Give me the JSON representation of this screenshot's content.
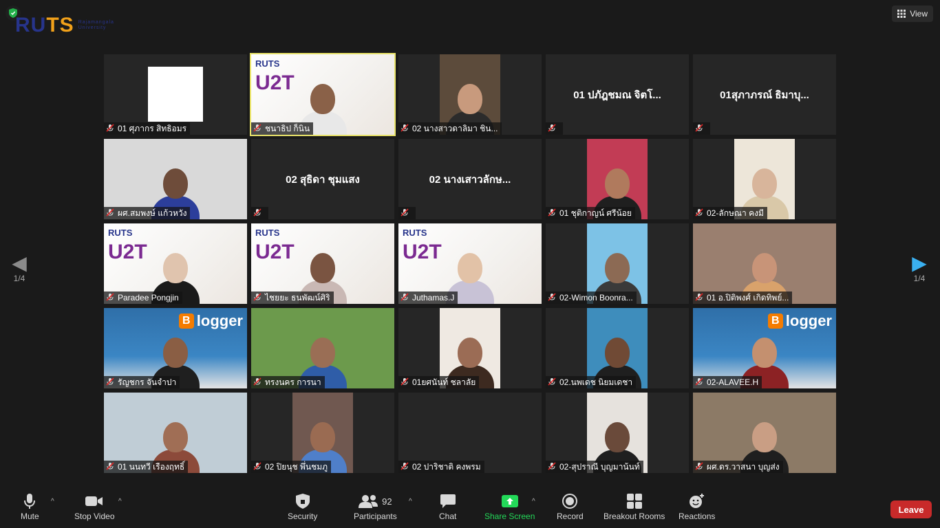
{
  "logo": {
    "part1": "RU",
    "part2": "TS",
    "sub": "Rajamangala University"
  },
  "view": {
    "label": "View"
  },
  "pagination": {
    "left": "1/4",
    "right": "1/4"
  },
  "tiles": [
    {
      "name": "01 ศุภากร สิทธิอมร",
      "type": "blank"
    },
    {
      "name": "ชนาธิป ก็นิน",
      "type": "u2t",
      "skin": "#8a6148",
      "shirt": "#e8e8e8",
      "active": true
    },
    {
      "name": "02 นางสาวดาลิมา ชิน...",
      "type": "narrow",
      "skin": "#c89a7d",
      "shirt": "#2b2b2b",
      "bg": "#5c4b3b"
    },
    {
      "name": "",
      "type": "text",
      "display": "01 ปภัฎชมณ จิตโ..."
    },
    {
      "name": "",
      "type": "text",
      "display": "01สุภาภรณ์ ธิมาบุ..."
    },
    {
      "name": "ผศ.สมพงษ์ แก้วหวัง",
      "type": "wide",
      "skin": "#6e4c3a",
      "shirt": "#2c3e9b",
      "bg": "#d9d9d9"
    },
    {
      "name": "",
      "type": "text",
      "display": "02 สุธิดา ชุมแสง"
    },
    {
      "name": "",
      "type": "text",
      "display": "02 นางเสาวลักษ..."
    },
    {
      "name": "01 ชุติกาญน์ ศรีน้อย",
      "type": "narrow",
      "skin": "#b07a5d",
      "shirt": "#1f1f1f",
      "bg": "#c23c55"
    },
    {
      "name": "02-ลักษณา คงมี",
      "type": "narrow",
      "skin": "#d8b59b",
      "shirt": "#d9c8a8",
      "bg": "#ede6d9"
    },
    {
      "name": "Paradee Pongjin",
      "type": "u2t",
      "skin": "#e0c4ae",
      "shirt": "#1a1a1a"
    },
    {
      "name": "ไชยยะ ธนพัฒน์ศิริ",
      "type": "u2t",
      "skin": "#7a5441",
      "shirt": "#c9b8b4"
    },
    {
      "name": "Juthamas.J",
      "type": "u2t",
      "skin": "#e2c2a7",
      "shirt": "#c8c2d6"
    },
    {
      "name": "02-Wimon Boonra...",
      "type": "narrow",
      "skin": "#8c6a54",
      "shirt": "#3a3a3a",
      "bg": "#7dc2e6"
    },
    {
      "name": "01 อ.ปิติพงศ์ เกิดทิพย์...",
      "type": "wide",
      "skin": "#c89478",
      "shirt": "#d9a26b",
      "bg": "#9a7f6f"
    },
    {
      "name": "รัญชกร จันจำปา",
      "type": "blogger",
      "skin": "#8a5e44",
      "shirt": "#1f1f1f"
    },
    {
      "name": "ทรงนคร การนา",
      "type": "wide",
      "skin": "#9a6e55",
      "shirt": "#2f5da8",
      "bg": "#6c9a4c"
    },
    {
      "name": "01ยศนันท์ ชลาลัย",
      "type": "narrow",
      "skin": "#9b6c55",
      "shirt": "#3d2a20",
      "bg": "#efe9e2"
    },
    {
      "name": "02.นพเดช นิยมเดชา",
      "type": "narrow",
      "skin": "#704a35",
      "shirt": "#1f1f1f",
      "bg": "#3e8dbc"
    },
    {
      "name": "02-ALAVEE.H",
      "type": "blogger",
      "skin": "#c4906f",
      "shirt": "#8c2224"
    },
    {
      "name": "01 นนทวี เรืองฤทธิ์",
      "type": "wide",
      "skin": "#a06e55",
      "shirt": "#8c4a3a",
      "bg": "#c0cdd6"
    },
    {
      "name": "02 ปิยนุช พึ่นชมภู",
      "type": "narrow",
      "skin": "#9a6b52",
      "shirt": "#4f7fc9",
      "bg": "#705850"
    },
    {
      "name": "02 ปาริชาติ คงพรม",
      "type": "blank2"
    },
    {
      "name": "02-สุปราณี บุญมาน้นท์",
      "type": "narrow",
      "skin": "#6a4a3a",
      "shirt": "#1f1f1f",
      "bg": "#e6e2dd"
    },
    {
      "name": "ผศ.ดร.วาสนา บุญส่ง",
      "type": "wide",
      "skin": "#c99e84",
      "shirt": "#1f1f1f",
      "bg": "#8c7a66"
    }
  ],
  "toolbar": {
    "mute": "Mute",
    "stop_video": "Stop Video",
    "security": "Security",
    "participants": "Participants",
    "participants_count": "92",
    "chat": "Chat",
    "share_screen": "Share Screen",
    "record": "Record",
    "breakout": "Breakout Rooms",
    "reactions": "Reactions",
    "leave": "Leave"
  },
  "colors": {
    "share_green": "#23d959",
    "leave_red": "#c82a2a",
    "active_outline": "#e9e36a"
  }
}
